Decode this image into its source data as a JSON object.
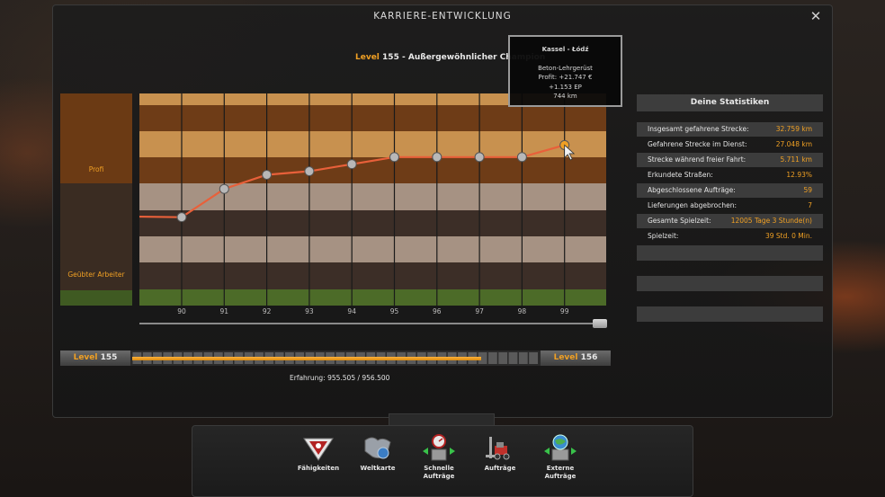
{
  "window": {
    "title": "KARRIERE-ENTWICKLUNG",
    "close_icon": "close-icon"
  },
  "level": {
    "word": "Level",
    "number": "155",
    "title": "- Außergewöhnlicher Champion"
  },
  "tiers": [
    {
      "label": "Profi"
    },
    {
      "label": "Geübter Arbeiter"
    }
  ],
  "chart_data": {
    "type": "line",
    "title": "",
    "x": [
      "90",
      "91",
      "92",
      "93",
      "94",
      "95",
      "96",
      "97",
      "98",
      "99"
    ],
    "series": [
      {
        "values": [
          142.5,
          146.5,
          148.5,
          149,
          150,
          151,
          151,
          151,
          151,
          152.7
        ]
      }
    ],
    "line_color": "#e8603a",
    "last_point_color": "#f0a024"
  },
  "tooltip": {
    "route": "Kassel - Łódź",
    "cargo": "Beton-Lehrgerüst",
    "profit": "Profit: +21.747 €",
    "xp": "+1.153 EP",
    "distance": "744 km"
  },
  "stats": {
    "header": "Deine Statistiken",
    "rows": [
      {
        "label": "Insgesamt gefahrene Strecke:",
        "value": "32.759 km"
      },
      {
        "label": "Gefahrene Strecke im Dienst:",
        "value": "27.048 km"
      },
      {
        "label": "Strecke während freier Fahrt:",
        "value": "5.711 km"
      },
      {
        "label": "Erkundete Straßen:",
        "value": "12.93%"
      },
      {
        "label": "Abgeschlossene Aufträge:",
        "value": "59"
      },
      {
        "label": "Lieferungen abgebrochen:",
        "value": "7"
      },
      {
        "label": "Gesamte Spielzeit:",
        "value": "12005 Tage 3 Stunde(n)"
      },
      {
        "label": "Spielzeit:",
        "value": "39 Std. 0 Min."
      }
    ]
  },
  "xp_bar": {
    "left_word": "Level",
    "left_level": "155",
    "right_word": "Level",
    "right_level": "156",
    "progress": 0.999,
    "text": "Erfahrung: 955.505 / 956.500",
    "accent": "#f0a024"
  },
  "nav": [
    {
      "label": "Fähigkeiten",
      "icon": "skills-icon"
    },
    {
      "label": "Weltkarte",
      "icon": "world-map-icon"
    },
    {
      "label": "Schnelle\nAufträge",
      "label1": "Schnelle",
      "label2": "Aufträge",
      "icon": "quick-jobs-icon"
    },
    {
      "label": "Aufträge",
      "icon": "freight-market-icon"
    },
    {
      "label": "Externe\nAufträge",
      "label1": "Externe",
      "label2": "Aufträge",
      "icon": "external-jobs-icon"
    }
  ]
}
